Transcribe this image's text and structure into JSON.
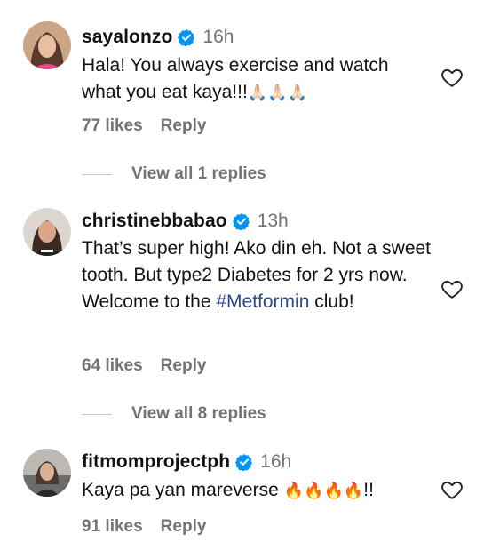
{
  "comments": [
    {
      "username": "sayalonzo",
      "time": "16h",
      "text": "Hala! You always exercise and watch what you eat kaya!!!",
      "emoji": "🙏🏻🙏🏻🙏🏻",
      "likes": "77 likes",
      "reply": "Reply",
      "view_replies": "View all 1 replies",
      "avatar_color": "#c9a07a"
    },
    {
      "username": "christinebbabao",
      "time": "13h",
      "text_before": "That’s super high! Ako din eh. Not a sweet tooth. But type2 Diabetes for 2 yrs now. Welcome to the ",
      "hashtag": "#Metformin",
      "text_after": " club!",
      "likes": "64 likes",
      "reply": "Reply",
      "view_replies": "View all 8 replies",
      "avatar_color": "#d9d4cf"
    },
    {
      "username": "fitmomprojectph",
      "time": "16h",
      "text": "Kaya pa yan mareverse ",
      "emoji": "🔥🔥🔥🔥",
      "text_after": "!!",
      "likes": "91 likes",
      "reply": "Reply",
      "avatar_color": "#b8b3ad"
    }
  ],
  "colors": {
    "verified_badge": "#0095f6",
    "hashtag": "#2b4a8b",
    "secondary_text": "#737373"
  }
}
